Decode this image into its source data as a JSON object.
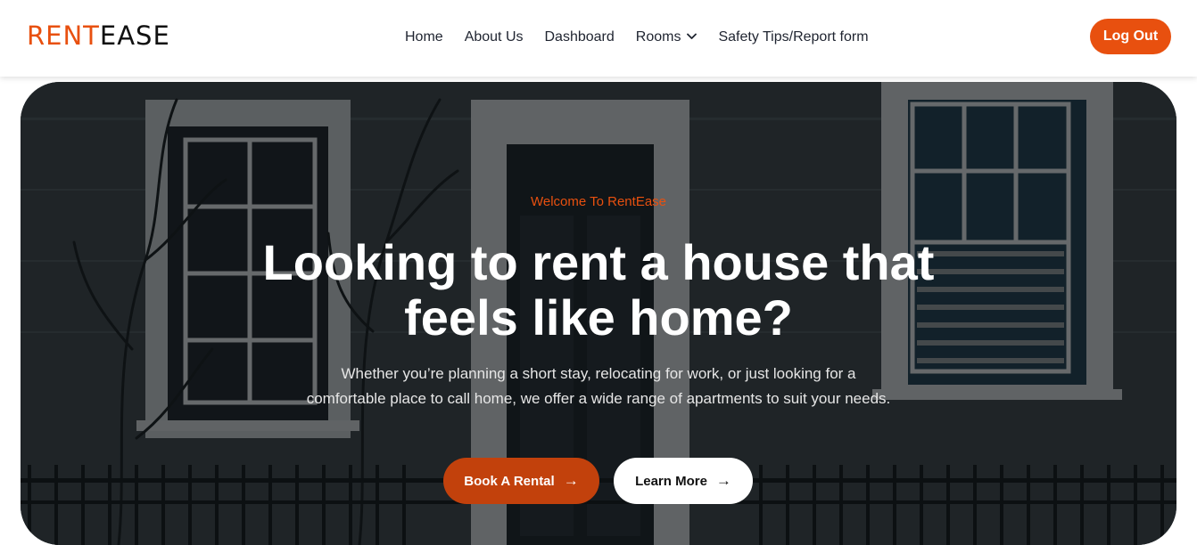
{
  "brand": {
    "name_part_a": "RENT",
    "name_part_b": "EASE",
    "accent_color": "#e8500f"
  },
  "nav": {
    "items": [
      {
        "label": "Home"
      },
      {
        "label": "About Us"
      },
      {
        "label": "Dashboard"
      },
      {
        "label": "Rooms",
        "icon": "chevron-down-icon"
      },
      {
        "label": "Safety Tips/Report form"
      }
    ],
    "logout_label": "Log Out"
  },
  "hero": {
    "eyebrow": "Welcome To RentEase",
    "headline_line1": "Looking to rent a house that",
    "headline_line2": "feels like home?",
    "subtext": "Whether you’re planning a short stay, relocating for work, or just looking for a comfortable place to call home, we offer a wide range of apartments to suit your needs.",
    "primary_button": {
      "label": "Book A Rental",
      "icon": "arrow-right-icon",
      "color": "#c2410c"
    },
    "secondary_button": {
      "label": "Learn More",
      "icon": "arrow-right-icon"
    },
    "background_image": "house-facade-photo"
  }
}
